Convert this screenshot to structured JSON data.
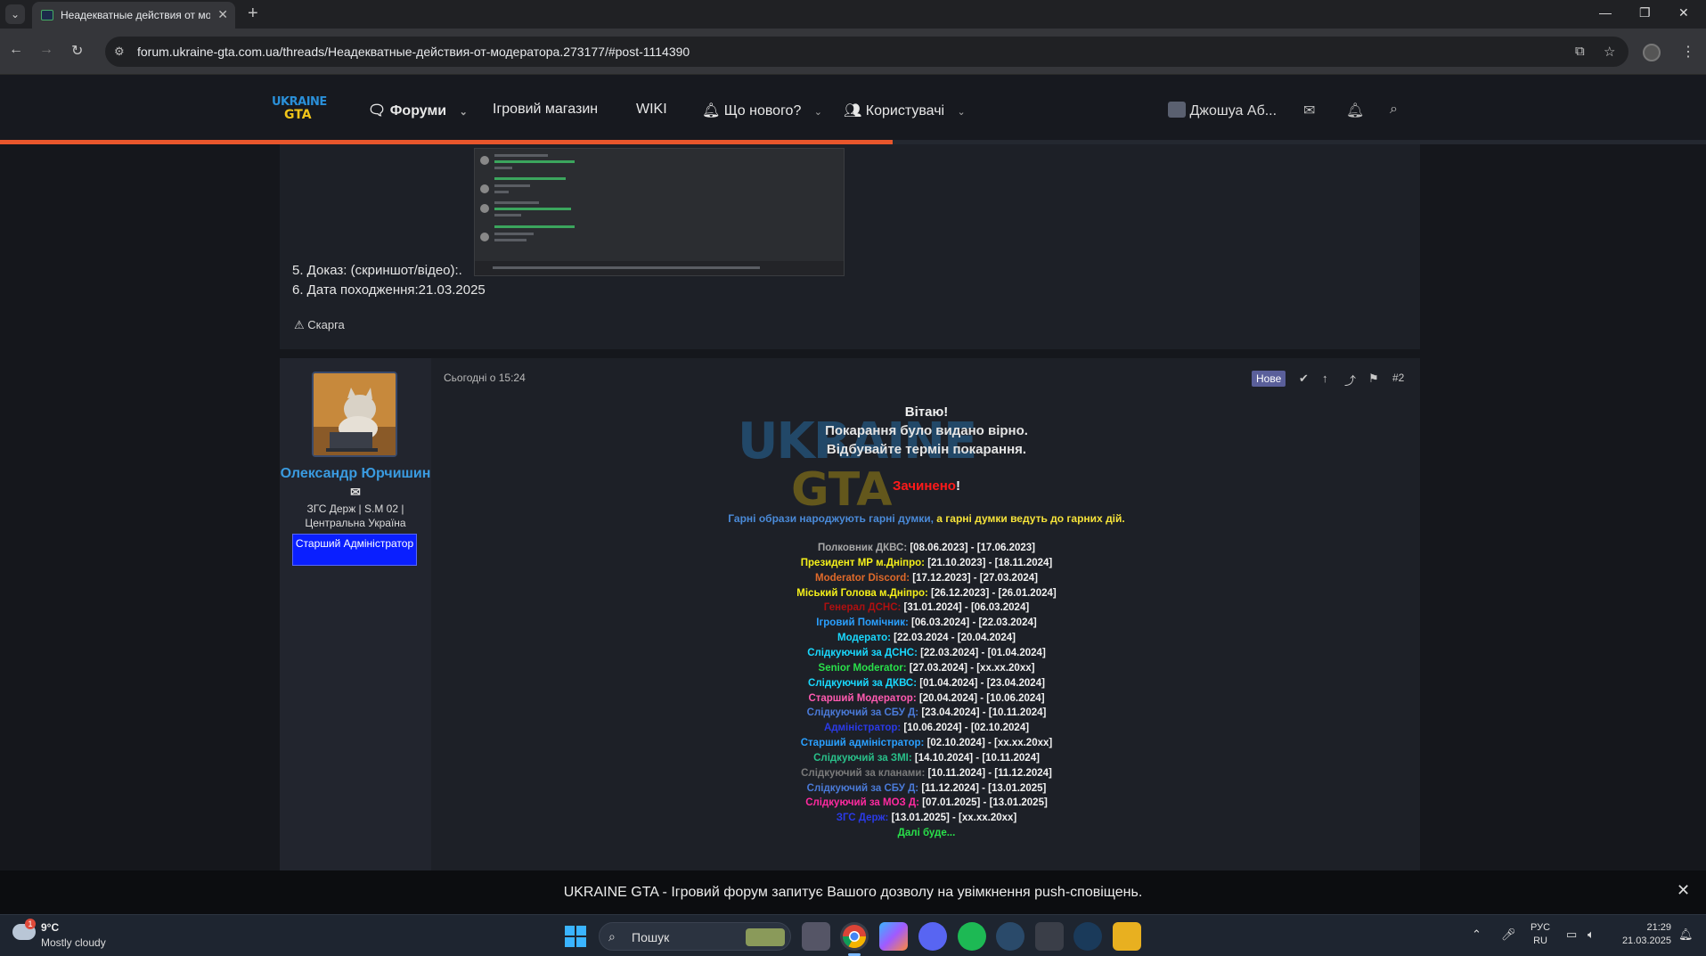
{
  "browser": {
    "tab_title": "Неадекватные действия от мо",
    "url": "forum.ukraine-gta.com.ua/threads/Неадекватные-действия-от-модератора.273177/#post-1114390",
    "new_tab_icon": "plus-icon"
  },
  "forum": {
    "logo_line1": "UKRAINE",
    "logo_line2": "GTA",
    "nav": {
      "forums": "Форуми",
      "shop": "Ігровий магазин",
      "wiki": "WIKI",
      "whats_new": "Що нового?",
      "users": "Користувачі"
    },
    "account_name": "Джошуа Аб...",
    "accent_color": "#e8562c"
  },
  "post1": {
    "line5": "5. Доказ: (скриншот/відео):.",
    "line6": "6. Дата походження:21.03.2025",
    "report": "Скарга"
  },
  "post2": {
    "author": "Олександр Юрчишин",
    "user_title": "ЗГС Держ | S.M 02 | Центральна Україна",
    "badge": "Старший Адміністратор",
    "date": "Сьогодні о 15:24",
    "new_label": "Нове",
    "post_number": "#2",
    "greeting": "Вітаю!",
    "line2": "Покарання було видано вірно.",
    "line3": "Відбувайте термін покарання.",
    "closed_word": "Зачинено",
    "closed_punct": "!",
    "motto_part1": "Гарні образи народжують гарні думки,",
    "motto_part2": " а гарні думки ведуть до гарних дій.",
    "signature": [
      {
        "role": "Полковник ДКВС:",
        "period": " [08.06.2023] - [17.06.2023]",
        "color": "#a8a8a8"
      },
      {
        "role": "Президент МР м.Дніпро:",
        "period": " [21.10.2023] - [18.11.2024]",
        "color": "#f5f01a"
      },
      {
        "role": "Moderator Discord:",
        "period": " [17.12.2023] - [27.03.2024]",
        "color": "#e06a2a"
      },
      {
        "role": "Міський Голова м.Дніпро:",
        "period": " [26.12.2023] - [26.01.2024]",
        "color": "#f5f01a"
      },
      {
        "role": "Генерал ДСНС:",
        "period": " [31.01.2024] - [06.03.2024]",
        "color": "#b01010"
      },
      {
        "role": "Ігровий Помічник:",
        "period": " [06.03.2024] - [22.03.2024]",
        "color": "#2aa0ff"
      },
      {
        "role": "Модерато:",
        "period": " [22.03.2024 - [20.04.2024]",
        "color": "#19d9ff"
      },
      {
        "role": "Слідкуючий за ДСНС:",
        "period": " [22.03.2024] - [01.04.2024]",
        "color": "#19d9ff"
      },
      {
        "role": "Senior Moderator:",
        "period": " [27.03.2024] - [xx.xx.20xx]",
        "color": "#29e04a"
      },
      {
        "role": "Слідкуючий за ДКВС:",
        "period": " [01.04.2024] - [23.04.2024]",
        "color": "#19d9ff"
      },
      {
        "role": "Старший Модератор:",
        "period": " [20.04.2024] - [10.06.2024]",
        "color": "#ff5ab0"
      },
      {
        "role": "Слідкуючий за СБУ Д:",
        "period": " [23.04.2024] - [10.11.2024]",
        "color": "#4a7ad8"
      },
      {
        "role": "Адміністратор:",
        "period": " [10.06.2024] - [02.10.2024]",
        "color": "#2a3ae8"
      },
      {
        "role": "Старший адміністратор:",
        "period": " [02.10.2024] - [xx.xx.20xx]",
        "color": "#2aa0ff"
      },
      {
        "role": "Слідкуючий за ЗМІ:",
        "period": " [14.10.2024] - [10.11.2024]",
        "color": "#29c08a"
      },
      {
        "role": "Слідкуючий за кланами:",
        "period": " [10.11.2024] - [11.12.2024]",
        "color": "#7a7a7a"
      },
      {
        "role": "Слідкуючий за СБУ Д:",
        "period": " [11.12.2024] - [13.01.2025]",
        "color": "#4a7ad8"
      },
      {
        "role": "Слідкуючий за МОЗ Д:",
        "period": " [07.01.2025] - [13.01.2025]",
        "color": "#ff2aa0"
      },
      {
        "role": "ЗГС Держ:",
        "period": " [13.01.2025] - [xx.xx.20xx]",
        "color": "#2a3ae8"
      },
      {
        "role": "Далі буде...",
        "period": "",
        "color": "#29e04a"
      }
    ]
  },
  "push_banner": "UKRAINE GTA - Ігровий форум запитує Вашого дозволу на увімкнення push-сповіщень.",
  "taskbar": {
    "temperature": "9°C",
    "weather": "Mostly cloudy",
    "weather_badge": "1",
    "search_placeholder": "Пошук",
    "lang1": "РУС",
    "lang2": "RU",
    "time": "21:29",
    "date": "21.03.2025"
  }
}
